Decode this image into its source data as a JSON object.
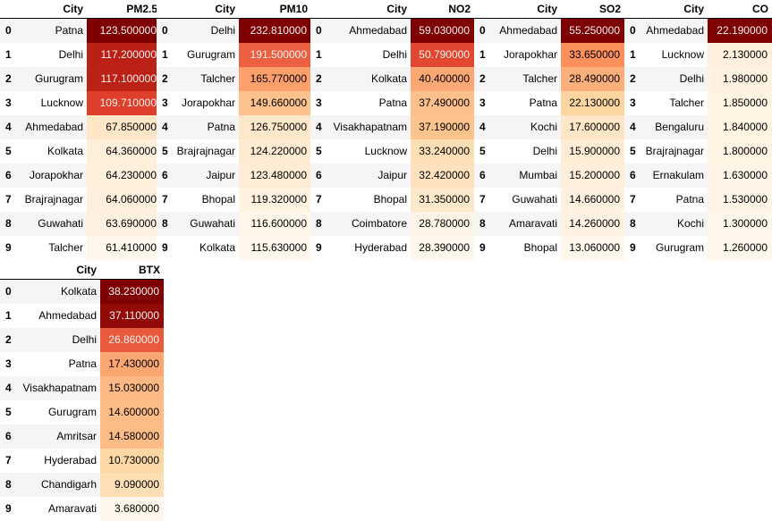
{
  "colors": {
    "max": "#7f0000",
    "mid": "#fc8d59",
    "min": "#fff7ec"
  },
  "tables": [
    {
      "id": "pm25",
      "city_header": "City",
      "value_header": "PM2.5",
      "rows": [
        {
          "i": "0",
          "city": "Patna",
          "value": "123.500000"
        },
        {
          "i": "1",
          "city": "Delhi",
          "value": "117.200000"
        },
        {
          "i": "2",
          "city": "Gurugram",
          "value": "117.100000"
        },
        {
          "i": "3",
          "city": "Lucknow",
          "value": "109.710000"
        },
        {
          "i": "4",
          "city": "Ahmedabad",
          "value": "67.850000"
        },
        {
          "i": "5",
          "city": "Kolkata",
          "value": "64.360000"
        },
        {
          "i": "6",
          "city": "Jorapokhar",
          "value": "64.230000"
        },
        {
          "i": "7",
          "city": "Brajrajnagar",
          "value": "64.060000"
        },
        {
          "i": "8",
          "city": "Guwahati",
          "value": "63.690000"
        },
        {
          "i": "9",
          "city": "Talcher",
          "value": "61.410000"
        }
      ]
    },
    {
      "id": "pm10",
      "city_header": "City",
      "value_header": "PM10",
      "rows": [
        {
          "i": "0",
          "city": "Delhi",
          "value": "232.810000"
        },
        {
          "i": "1",
          "city": "Gurugram",
          "value": "191.500000"
        },
        {
          "i": "2",
          "city": "Talcher",
          "value": "165.770000"
        },
        {
          "i": "3",
          "city": "Jorapokhar",
          "value": "149.660000"
        },
        {
          "i": "4",
          "city": "Patna",
          "value": "126.750000"
        },
        {
          "i": "5",
          "city": "Brajrajnagar",
          "value": "124.220000"
        },
        {
          "i": "6",
          "city": "Jaipur",
          "value": "123.480000"
        },
        {
          "i": "7",
          "city": "Bhopal",
          "value": "119.320000"
        },
        {
          "i": "8",
          "city": "Guwahati",
          "value": "116.600000"
        },
        {
          "i": "9",
          "city": "Kolkata",
          "value": "115.630000"
        }
      ]
    },
    {
      "id": "no2",
      "city_header": "City",
      "value_header": "NO2",
      "rows": [
        {
          "i": "0",
          "city": "Ahmedabad",
          "value": "59.030000"
        },
        {
          "i": "1",
          "city": "Delhi",
          "value": "50.790000"
        },
        {
          "i": "2",
          "city": "Kolkata",
          "value": "40.400000"
        },
        {
          "i": "3",
          "city": "Patna",
          "value": "37.490000"
        },
        {
          "i": "4",
          "city": "Visakhapatnam",
          "value": "37.190000"
        },
        {
          "i": "5",
          "city": "Lucknow",
          "value": "33.240000"
        },
        {
          "i": "6",
          "city": "Jaipur",
          "value": "32.420000"
        },
        {
          "i": "7",
          "city": "Bhopal",
          "value": "31.350000"
        },
        {
          "i": "8",
          "city": "Coimbatore",
          "value": "28.780000"
        },
        {
          "i": "9",
          "city": "Hyderabad",
          "value": "28.390000"
        }
      ]
    },
    {
      "id": "so2",
      "city_header": "City",
      "value_header": "SO2",
      "rows": [
        {
          "i": "0",
          "city": "Ahmedabad",
          "value": "55.250000"
        },
        {
          "i": "1",
          "city": "Jorapokhar",
          "value": "33.650000"
        },
        {
          "i": "2",
          "city": "Talcher",
          "value": "28.490000"
        },
        {
          "i": "3",
          "city": "Patna",
          "value": "22.130000"
        },
        {
          "i": "4",
          "city": "Kochi",
          "value": "17.600000"
        },
        {
          "i": "5",
          "city": "Delhi",
          "value": "15.900000"
        },
        {
          "i": "6",
          "city": "Mumbai",
          "value": "15.200000"
        },
        {
          "i": "7",
          "city": "Guwahati",
          "value": "14.660000"
        },
        {
          "i": "8",
          "city": "Amaravati",
          "value": "14.260000"
        },
        {
          "i": "9",
          "city": "Bhopal",
          "value": "13.060000"
        }
      ]
    },
    {
      "id": "co",
      "city_header": "City",
      "value_header": "CO",
      "rows": [
        {
          "i": "0",
          "city": "Ahmedabad",
          "value": "22.190000"
        },
        {
          "i": "1",
          "city": "Lucknow",
          "value": "2.130000"
        },
        {
          "i": "2",
          "city": "Delhi",
          "value": "1.980000"
        },
        {
          "i": "3",
          "city": "Talcher",
          "value": "1.850000"
        },
        {
          "i": "4",
          "city": "Bengaluru",
          "value": "1.840000"
        },
        {
          "i": "5",
          "city": "Brajrajnagar",
          "value": "1.800000"
        },
        {
          "i": "6",
          "city": "Ernakulam",
          "value": "1.630000"
        },
        {
          "i": "7",
          "city": "Patna",
          "value": "1.530000"
        },
        {
          "i": "8",
          "city": "Kochi",
          "value": "1.300000"
        },
        {
          "i": "9",
          "city": "Gurugram",
          "value": "1.260000"
        }
      ]
    },
    {
      "id": "btx",
      "city_header": "City",
      "value_header": "BTX",
      "rows": [
        {
          "i": "0",
          "city": "Kolkata",
          "value": "38.230000"
        },
        {
          "i": "1",
          "city": "Ahmedabad",
          "value": "37.110000"
        },
        {
          "i": "2",
          "city": "Delhi",
          "value": "26.860000"
        },
        {
          "i": "3",
          "city": "Patna",
          "value": "17.430000"
        },
        {
          "i": "4",
          "city": "Visakhapatnam",
          "value": "15.030000"
        },
        {
          "i": "5",
          "city": "Gurugram",
          "value": "14.600000"
        },
        {
          "i": "6",
          "city": "Amritsar",
          "value": "14.580000"
        },
        {
          "i": "7",
          "city": "Hyderabad",
          "value": "10.730000"
        },
        {
          "i": "8",
          "city": "Chandigarh",
          "value": "9.090000"
        },
        {
          "i": "9",
          "city": "Amaravati",
          "value": "3.680000"
        }
      ]
    }
  ]
}
